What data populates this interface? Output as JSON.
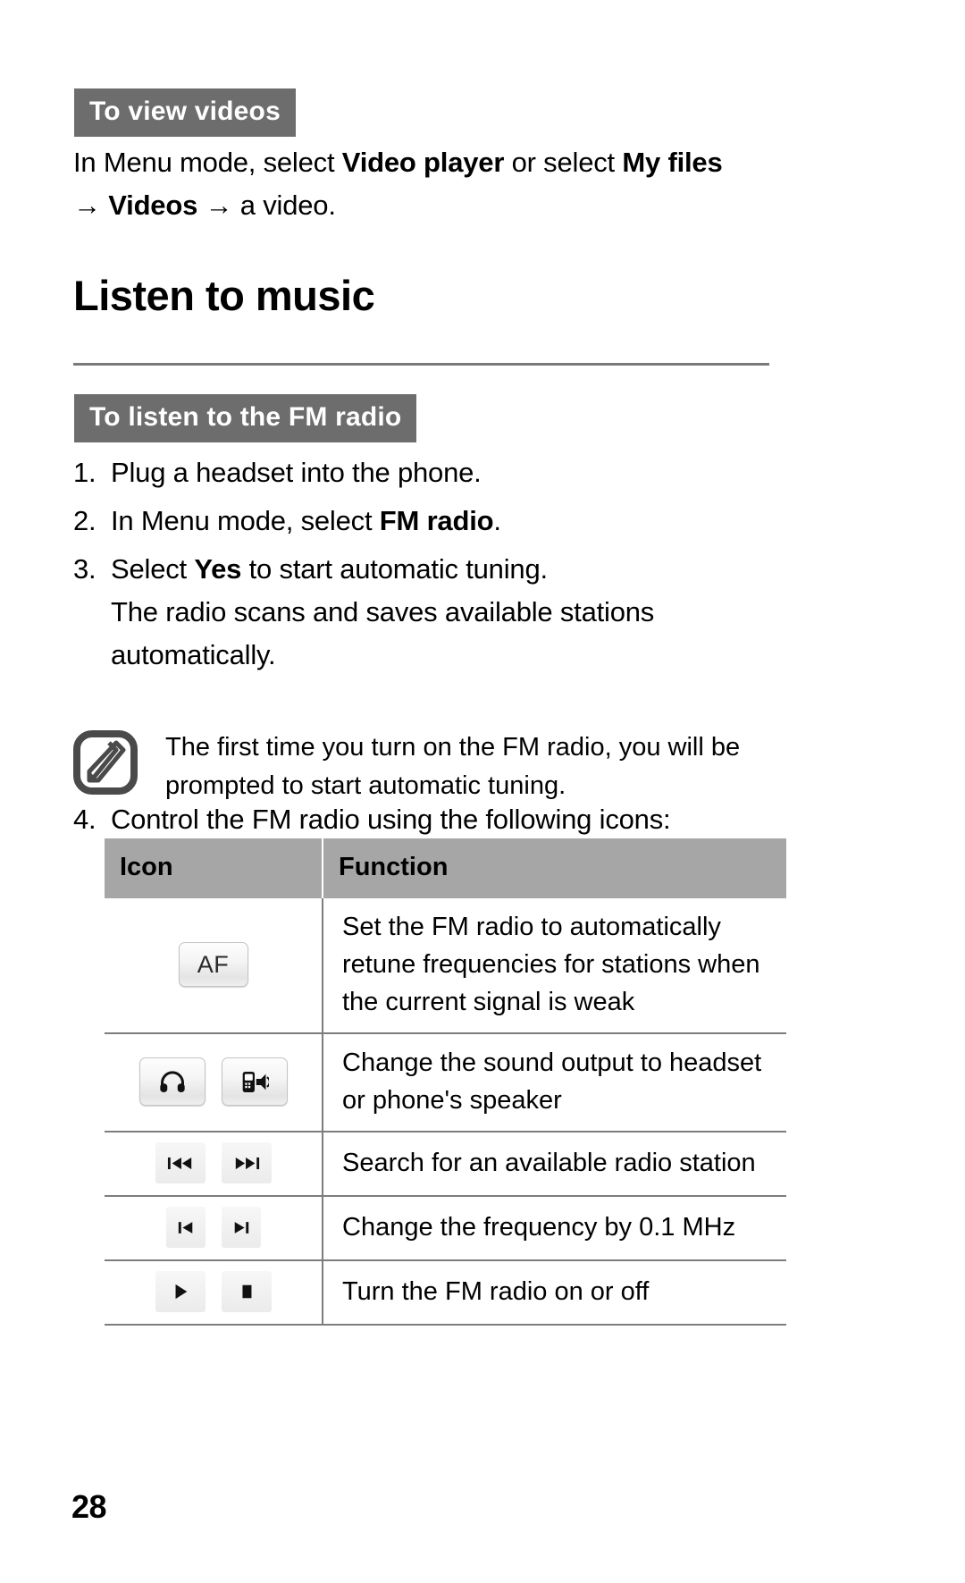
{
  "page": {
    "number": "28"
  },
  "video_section": {
    "heading": "To view videos",
    "paragraph": {
      "part1": "In Menu mode, select ",
      "bold1": "Video player",
      "part2": " or select ",
      "bold2": "My files",
      "arrow1": "→",
      "bold3": "Videos",
      "arrow2": "→",
      "part3": "a video."
    }
  },
  "music_section": {
    "title": "Listen to music",
    "fm_heading": "To listen to the FM radio",
    "steps": [
      {
        "num": "1.",
        "text": "Plug a headset into the phone."
      },
      {
        "num": "2.",
        "text_pre": "In Menu mode, select ",
        "bold": "FM radio",
        "text_post": "."
      },
      {
        "num": "3.",
        "text_pre": "Select ",
        "bold": "Yes",
        "text_post": " to start automatic tuning.",
        "continuation": "The radio scans and saves available stations automatically."
      },
      {
        "num": "4.",
        "text": "Control the FM radio using the following icons:"
      }
    ],
    "note": {
      "icon": "note-pencil-icon",
      "text": "The first time you turn on the FM radio, you will be prompted to start automatic tuning."
    },
    "table": {
      "headers": [
        "Icon",
        "Function"
      ],
      "rows": [
        {
          "icons": [
            "af-button-icon"
          ],
          "icon_labels": [
            "AF"
          ],
          "function": "Set the FM radio to automatically retune frequencies for stations when the current signal is weak"
        },
        {
          "icons": [
            "headset-icon",
            "phone-speaker-icon"
          ],
          "icon_labels": [
            "",
            ""
          ],
          "function": "Change the sound output to headset or phone's speaker"
        },
        {
          "icons": [
            "rewind-search-icon",
            "fast-forward-search-icon"
          ],
          "icon_labels": [
            "",
            ""
          ],
          "function": "Search for an available radio station"
        },
        {
          "icons": [
            "step-back-icon",
            "step-forward-icon"
          ],
          "icon_labels": [
            "",
            ""
          ],
          "function": "Change the frequency by 0.1 MHz"
        },
        {
          "icons": [
            "play-icon",
            "stop-icon"
          ],
          "icon_labels": [
            "",
            ""
          ],
          "function": "Turn the FM radio on or off"
        }
      ]
    }
  },
  "colors": {
    "heading_block_bg": "#6d6d6d",
    "heading_block_text": "#ffffff",
    "table_header_bg": "#a6a6a6",
    "rule": "#7a7a7a",
    "text": "#000000"
  }
}
